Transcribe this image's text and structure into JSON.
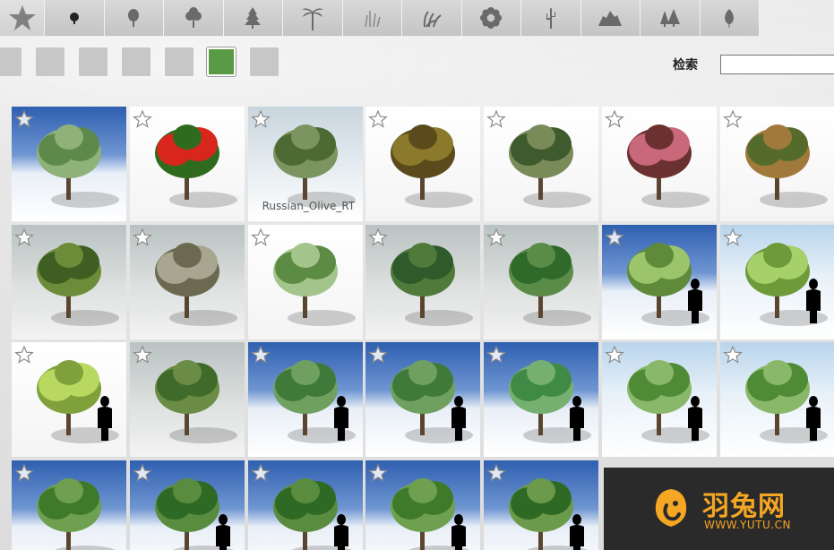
{
  "tabs": [
    {
      "icon": "star-icon"
    },
    {
      "icon": "small-shrub-icon"
    },
    {
      "icon": "round-tree-icon"
    },
    {
      "icon": "broadleaf-tree-icon"
    },
    {
      "icon": "conifer-tree-icon"
    },
    {
      "icon": "palm-tree-icon"
    },
    {
      "icon": "grass-icon"
    },
    {
      "icon": "tall-grass-icon"
    },
    {
      "icon": "flower-icon"
    },
    {
      "icon": "cactus-icon"
    },
    {
      "icon": "rock-icon"
    },
    {
      "icon": "forest-icon"
    },
    {
      "icon": "leaf-icon"
    }
  ],
  "swatches": [
    {
      "color": "#c7c7c7",
      "active": false
    },
    {
      "color": "#c7c7c7",
      "active": false
    },
    {
      "color": "#c7c7c7",
      "active": false
    },
    {
      "color": "#c7c7c7",
      "active": false
    },
    {
      "color": "#c7c7c7",
      "active": false
    },
    {
      "color": "#5b9a45",
      "active": true
    },
    {
      "color": "#c7c7c7",
      "active": false
    }
  ],
  "search": {
    "label": "检索",
    "value": ""
  },
  "thumbnails": [
    {
      "label": ""
    },
    {
      "label": ""
    },
    {
      "label": "Russian_Olive_RT"
    },
    {
      "label": ""
    },
    {
      "label": ""
    },
    {
      "label": ""
    },
    {
      "label": ""
    },
    {
      "label": ""
    },
    {
      "label": ""
    },
    {
      "label": ""
    },
    {
      "label": ""
    },
    {
      "label": ""
    },
    {
      "label": ""
    },
    {
      "label": ""
    },
    {
      "label": ""
    },
    {
      "label": ""
    },
    {
      "label": ""
    },
    {
      "label": ""
    },
    {
      "label": ""
    },
    {
      "label": ""
    },
    {
      "label": ""
    },
    {
      "label": ""
    },
    {
      "label": ""
    },
    {
      "label": ""
    },
    {
      "label": ""
    },
    {
      "label": ""
    }
  ],
  "watermark": {
    "title": "羽兔网",
    "url": "WWW.YUTU.CN"
  },
  "colors": {
    "accent_green": "#5b9a45",
    "watermark_orange": "#f5a623"
  }
}
